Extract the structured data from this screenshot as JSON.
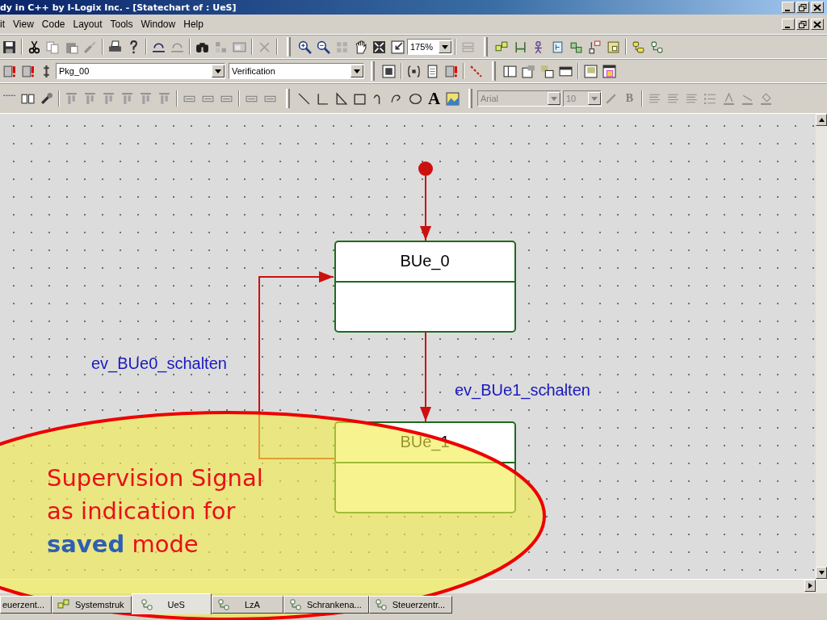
{
  "window": {
    "title": "dy in C++ by I-Logix Inc. - [Statechart of : UeS]"
  },
  "menu": [
    "it",
    "View",
    "Code",
    "Layout",
    "Tools",
    "Window",
    "Help"
  ],
  "toolbar": {
    "zoom": "175%",
    "package": "Pkg_00",
    "configuration": "Verification",
    "text_tool": "A",
    "font": "Arial",
    "font_size": "10",
    "bold": "B"
  },
  "diagram": {
    "states": [
      {
        "name": "BUe_0"
      },
      {
        "name": "BUe_1"
      }
    ],
    "transitions": [
      {
        "label": "ev_BUe0_schalten"
      },
      {
        "label": "ev_BUe1_schalten"
      }
    ]
  },
  "tabs": [
    {
      "label": "euerzent...",
      "kind": "plain",
      "selected": false
    },
    {
      "label": "Systemstruk",
      "kind": "structure",
      "selected": false
    },
    {
      "label": "UeS",
      "kind": "statechart",
      "selected": true
    },
    {
      "label": "LzA",
      "kind": "statechart",
      "selected": false
    },
    {
      "label": "Schrankena...",
      "kind": "statechart",
      "selected": false
    },
    {
      "label": "Steuerzentr...",
      "kind": "statechart",
      "selected": false
    }
  ],
  "callout": {
    "text": "Supervision Signal\nas indication for\n**saved** mode"
  }
}
